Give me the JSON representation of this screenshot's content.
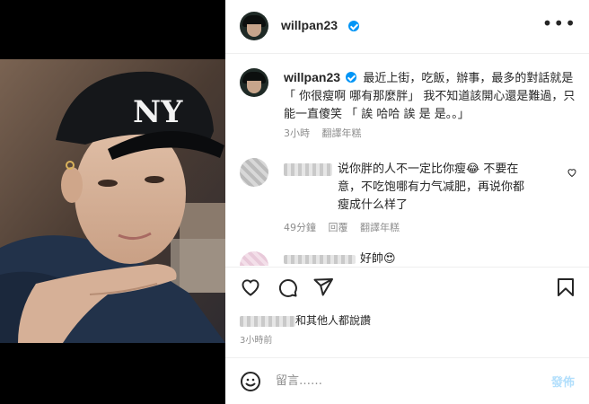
{
  "post": {
    "username": "willpan23",
    "caption": "最近上街，吃飯，辦事，最多的對話就是 「 你很瘦啊 哪有那麼胖」 我不知道該開心還是難過，只能一直傻笑 「 誒 哈哈 誒 是 是。。」",
    "caption_time": "3小時",
    "see_translation": "翻譯年糕",
    "liked_by_suffix": "和其他人都說讚",
    "time_ago": "3小時前"
  },
  "comments": [
    {
      "text": "说你胖的人不一定比你瘦😂 不要在意，不吃饱哪有力气减肥，再说你都瘦成什么样了",
      "time": "49分鐘",
      "reply": "回覆",
      "see_translation": "翻譯年糕"
    },
    {
      "text": "好帥😍"
    }
  ],
  "comment_box": {
    "placeholder": "留言……",
    "post_label": "發佈"
  },
  "icons": {
    "like": "heart-icon",
    "comment": "comment-icon",
    "share": "share-icon",
    "save": "bookmark-icon",
    "emoji": "emoji-icon",
    "more": "more-options-icon",
    "verified": "verified-badge-icon"
  },
  "colors": {
    "verified": "#0095f6",
    "post_button_disabled": "#b2dffc",
    "meta_text": "#8e8e8e"
  }
}
